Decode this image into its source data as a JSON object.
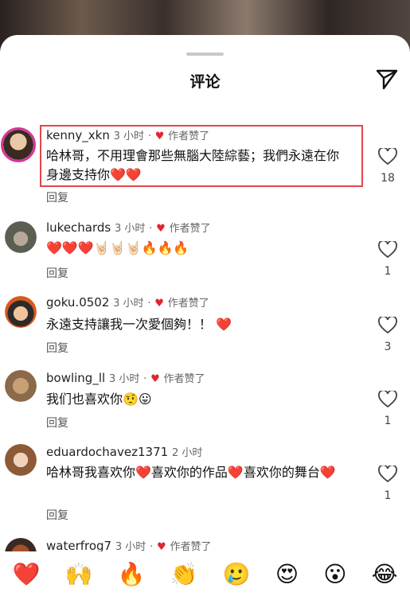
{
  "header": {
    "title": "评论"
  },
  "comments": [
    {
      "username": "kenny_xkn",
      "time": "3 小时",
      "liked_label": "作者赞了",
      "text": "哈林哥，不用理會那些無腦大陸綜藝；我們永遠在你身邊支持你❤️❤️",
      "reply": "回复",
      "likes": "18"
    },
    {
      "username": "lukechards",
      "time": "3 小时",
      "liked_label": "作者赞了",
      "text": "❤️❤️❤️🤘🏻🤘🏻🤘🏻🔥🔥🔥",
      "reply": "回复",
      "likes": "1"
    },
    {
      "username": "goku.0502",
      "time": "3 小时",
      "liked_label": "作者赞了",
      "text": "永遠支持讓我一次愛個夠！！ ❤️",
      "reply": "回复",
      "likes": "3"
    },
    {
      "username": "bowling_ll",
      "time": "3 小时",
      "liked_label": "作者赞了",
      "text": "我们也喜欢你🤨😛",
      "reply": "回复",
      "likes": "1"
    },
    {
      "username": "eduardochavez1371",
      "time": "2 小时",
      "liked_label": "",
      "text": "哈林哥我喜欢你❤️喜欢你的作品❤️喜欢你的舞台❤️",
      "reply": "回复",
      "likes": "1"
    },
    {
      "username": "waterfrog7",
      "time": "3 小时",
      "liked_label": "作者赞了"
    }
  ],
  "emoji_bar": [
    "❤️",
    "🙌",
    "🔥",
    "👏",
    "🥲",
    "😍",
    "😮",
    "😂"
  ]
}
